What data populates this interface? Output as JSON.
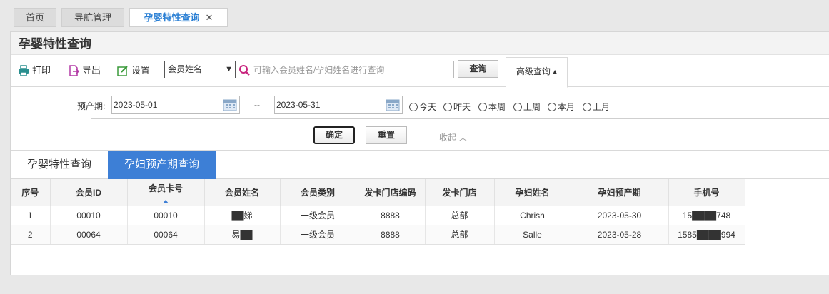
{
  "tabs": [
    {
      "label": "首页"
    },
    {
      "label": "导航管理"
    },
    {
      "label": "孕婴特性查询",
      "active": true,
      "close": "✕"
    }
  ],
  "panel": {
    "title": "孕婴特性查询"
  },
  "toolbar": {
    "print_label": "打印",
    "export_label": "导出",
    "settings_label": "设置",
    "field_select": "会员姓名",
    "search_placeholder": "可输入会员姓名/孕妇姓名进行查询",
    "query_label": "查询",
    "advanced_label": "高级查询 ▴"
  },
  "advanced": {
    "due_label": "预产期:",
    "date_from": "2023-05-01",
    "date_to": "2023-05-31",
    "dash": "--",
    "radios": [
      "今天",
      "昨天",
      "本周",
      "上周",
      "本月",
      "上月"
    ],
    "confirm_label": "确定",
    "reset_label": "重置",
    "collapse_label": "收起 ︿"
  },
  "subtabs": [
    "孕婴特性查询",
    "孕妇预产期查询"
  ],
  "table": {
    "columns": [
      "序号",
      "会员ID",
      "会员卡号",
      "会员姓名",
      "会员类别",
      "发卡门店编码",
      "发卡门店",
      "孕妇姓名",
      "孕妇预产期",
      "手机号"
    ],
    "rows": [
      [
        "1",
        "00010",
        "00010",
        "██娣",
        "一级会员",
        "8888",
        "总部",
        "Chrish",
        "2023-05-30",
        "15████748"
      ],
      [
        "2",
        "00064",
        "00064",
        "易██",
        "一级会员",
        "8888",
        "总部",
        "Salle",
        "2023-05-28",
        "1585████994"
      ]
    ]
  },
  "colors": {
    "accent": "#3d7fd6",
    "active_tab_text": "#2a7fd4"
  }
}
